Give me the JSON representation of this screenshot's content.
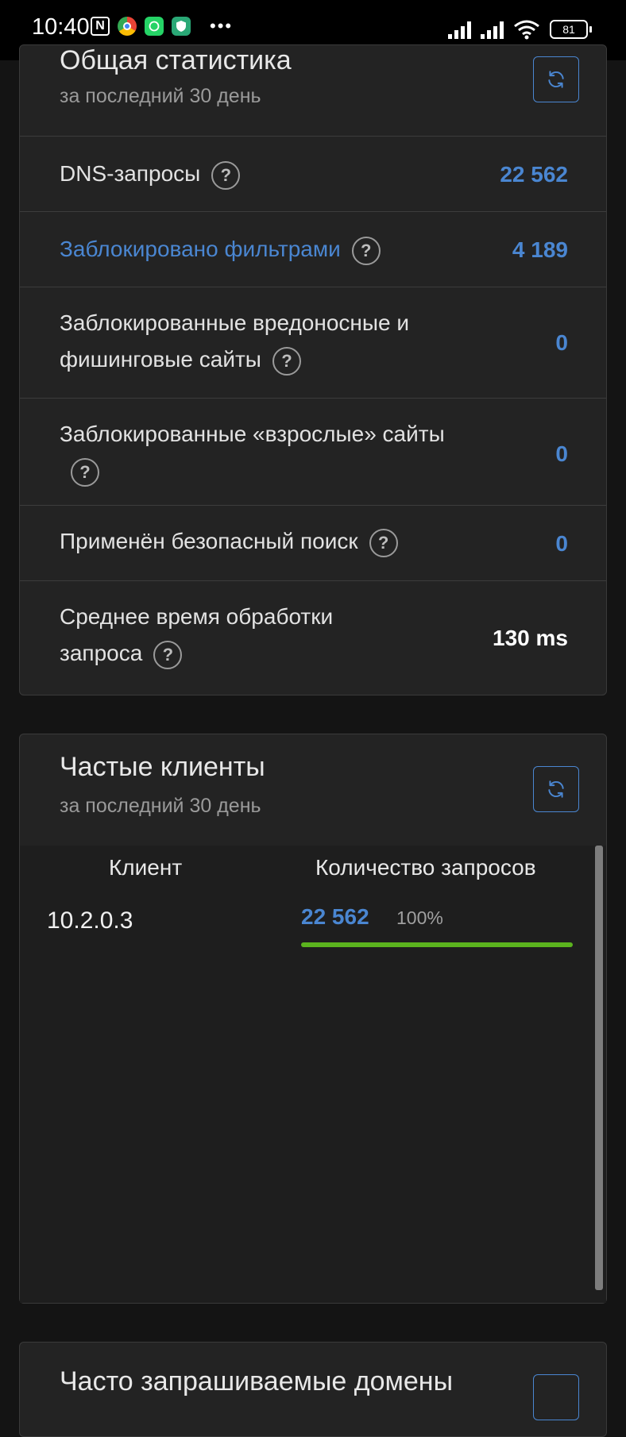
{
  "status_bar": {
    "time": "10:40",
    "battery": "81"
  },
  "general_stats": {
    "title": "Общая статистика",
    "subtitle": "за последний 30 день",
    "rows": [
      {
        "label": "DNS-запросы",
        "value": "22 562"
      },
      {
        "label": "Заблокировано фильтрами",
        "value": "4 189"
      },
      {
        "label_line1": "Заблокированные вредоносные и",
        "label_line2": "фишинговые сайты",
        "value": "0"
      },
      {
        "label_line1": "Заблокированные «взрослые» сайты",
        "value": "0"
      },
      {
        "label": "Применён безопасный поиск",
        "value": "0"
      },
      {
        "label_line1": "Среднее время обработки",
        "label_line2": "запроса",
        "value": "130 ms"
      }
    ],
    "help_glyph": "?"
  },
  "top_clients": {
    "title": "Частые клиенты",
    "subtitle": "за последний 30 день",
    "columns": [
      "Клиент",
      "Количество запросов"
    ],
    "rows": [
      {
        "client": "10.2.0.3",
        "count": "22 562",
        "percent": "100%",
        "share": 1.0
      }
    ]
  },
  "top_domains": {
    "title": "Часто запрашиваемые домены"
  },
  "colors": {
    "accent_blue": "#4a86d1",
    "bar_green": "#5bb31e",
    "card_bg": "#232323",
    "page_bg": "#141414"
  }
}
